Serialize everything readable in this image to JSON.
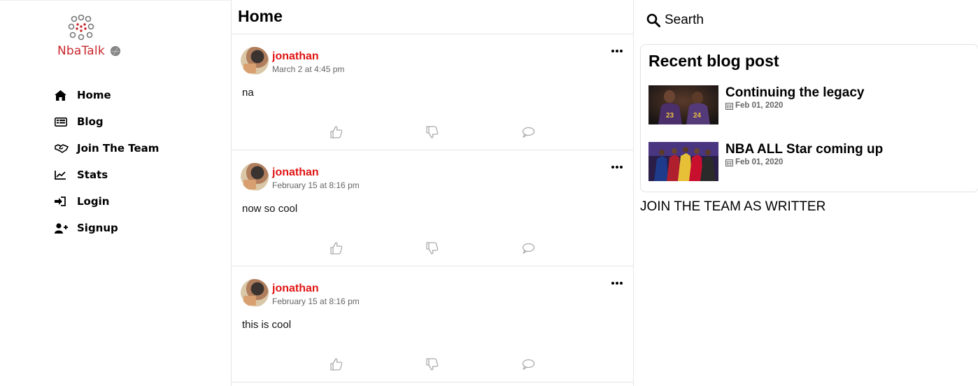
{
  "brand": {
    "name": "NbaTalk",
    "accent": "#c9262a"
  },
  "nav": {
    "items": [
      {
        "label": "Home",
        "icon": "home-icon"
      },
      {
        "label": "Blog",
        "icon": "blog-icon"
      },
      {
        "label": "Join The Team",
        "icon": "handshake-icon"
      },
      {
        "label": "Stats",
        "icon": "chart-icon"
      },
      {
        "label": "Login",
        "icon": "sign-in-icon"
      },
      {
        "label": "Signup",
        "icon": "user-plus-icon"
      }
    ]
  },
  "feed": {
    "title": "Home",
    "posts": [
      {
        "author": "jonathan",
        "date": "March 2 at 4:45 pm",
        "text": "na"
      },
      {
        "author": "jonathan",
        "date": "February 15 at 8:16 pm",
        "text": "now so cool"
      },
      {
        "author": "jonathan",
        "date": "February 15 at 8:16 pm",
        "text": "this is cool"
      }
    ]
  },
  "search": {
    "label": "Searth",
    "icon": "search-icon"
  },
  "recent": {
    "title": "Recent blog post",
    "items": [
      {
        "title": "Continuing the legacy",
        "date": "Feb 01, 2020"
      },
      {
        "title": "NBA ALL Star coming up",
        "date": "Feb 01, 2020"
      }
    ]
  },
  "join": {
    "label": "JOIN THE TEAM AS WRITTER"
  },
  "colors": {
    "author": "#e11414",
    "border": "#e6e6e6"
  }
}
